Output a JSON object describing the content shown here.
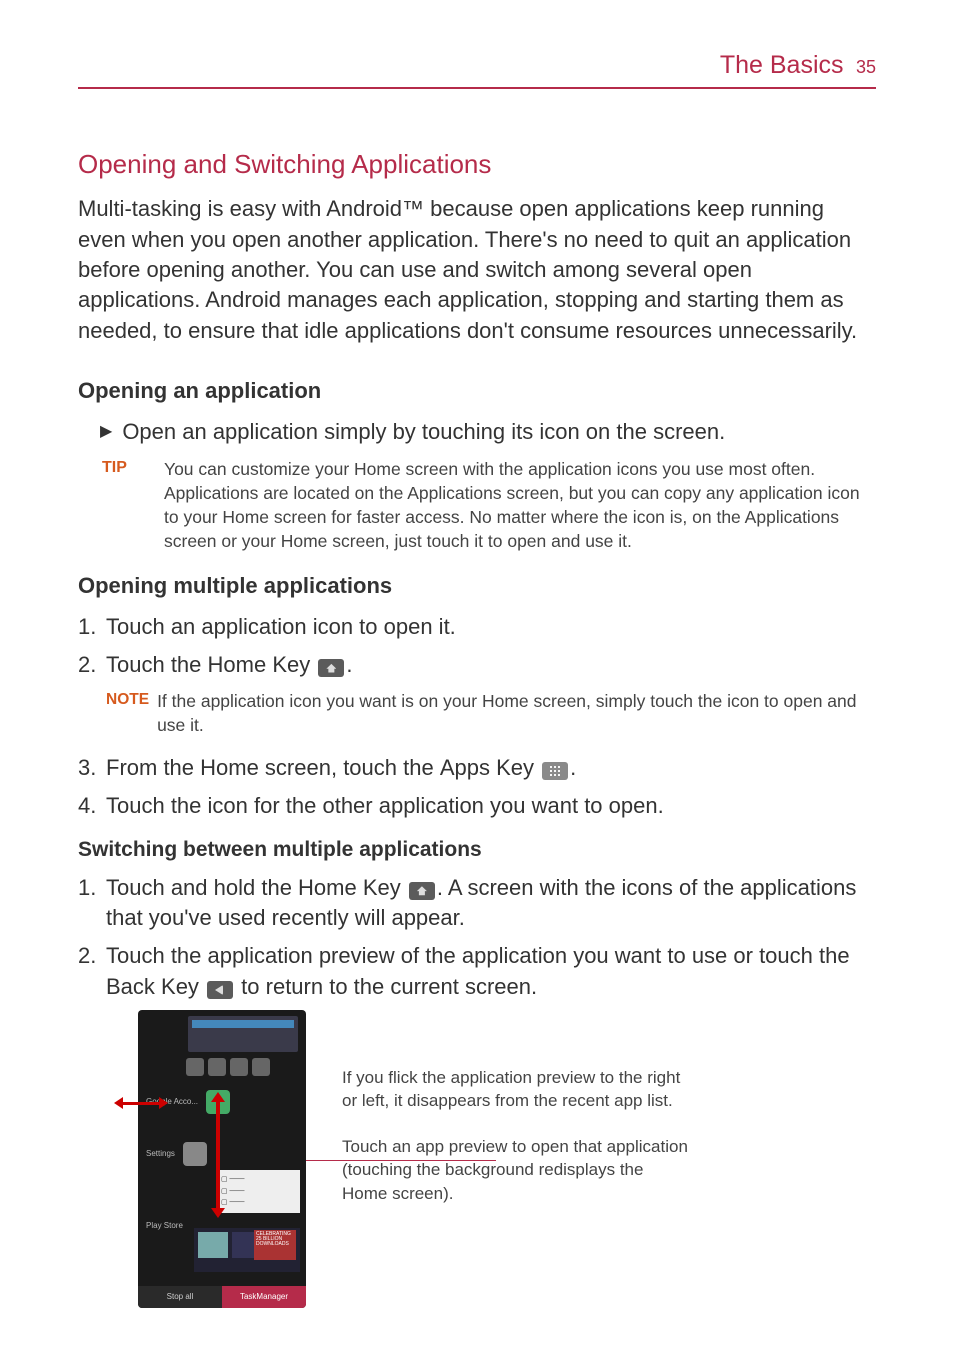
{
  "header": {
    "title": "The Basics",
    "page": "35"
  },
  "h1": "Opening and Switching Applications",
  "intro": "Multi-tasking is easy with Android™ because open applications keep running even when you open another application. There's no need to quit an application before opening another. You can use and switch among several open applications. Android manages each application, stopping and starting them as needed, to ensure that idle applications don't consume resources unnecessarily.",
  "sec1_h": "Opening an application",
  "sec1_bullet": "Open an application simply by touching its icon on the screen.",
  "tip_label": "TIP",
  "tip_body": "You can customize your Home screen with the application icons you use most often. Applications are located on the Applications screen, but you can copy any application icon to your Home screen for faster access. No matter where the icon is, on the Applications screen or your Home screen, just touch it to open and use it.",
  "sec2_h": "Opening multiple applications",
  "sec2_1": "Touch an application icon to open it.",
  "sec2_2a": "Touch the ",
  "sec2_2b": "Home Key",
  "sec2_2c": ".",
  "note_label": "NOTE",
  "note_body": "If the application icon you want is on your Home screen, simply touch the icon to open and use it.",
  "sec2_3a": "From the Home screen, touch the ",
  "sec2_3b": "Apps Key",
  "sec2_3c": ".",
  "sec2_4": "Touch the icon for the other application you want to open.",
  "sec3_h": "Switching between multiple applications",
  "sec3_1a": "Touch and hold the ",
  "sec3_1b": "Home Key",
  "sec3_1c": ". A screen with the icons of the applications that you've used recently will appear.",
  "sec3_2a": "Touch the application preview of the application you want to use or touch the ",
  "sec3_2b": "Back Key",
  "sec3_2c": " to return to the current screen.",
  "callout1": "If you flick the application preview to the right or left, it disappears from the recent app list.",
  "callout2": "Touch an app preview to open that application (touching the background redisplays the Home screen).",
  "phone": {
    "row1": "Google Acco...",
    "row2": "Settings",
    "row3": "Play Store",
    "btn1": "Stop all",
    "btn2": "TaskManager",
    "badge": "CELEBRATING 25 BILLION DOWNLOADS"
  }
}
